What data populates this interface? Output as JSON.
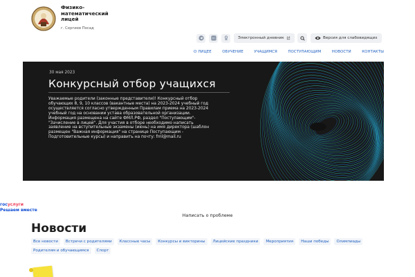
{
  "header": {
    "school_name_lines": [
      "Физико-",
      "математический",
      "лицей"
    ],
    "city": "г. Сергиев Посад",
    "diary_label": "Электронный дневник",
    "vision_label": "Версия для слабовидящих",
    "icons": [
      "telegram-icon",
      "vk-icon",
      "ok-icon",
      "search-icon",
      "eye-icon"
    ]
  },
  "nav": {
    "items": [
      "О ЛИЦЕЕ",
      "ОБУЧЕНИЕ",
      "УЧАЩИМСЯ",
      "ПОСТУПАЮЩИМ",
      "НОВОСТИ",
      "КОНТАКТЫ"
    ]
  },
  "hero": {
    "date": "30 мая 2023",
    "title": "Конкурсный отбор учащихся",
    "body": "Уважаемые родители (законные представители)! Конкурсный отбор обучающих 8, 9, 10 классов (вакантные места) на 2023-2024 учебный год осуществляется согласно утвержденным Правилам приема на 2023-2024 учебный год на основании устава образовательной организации. Информация размещена на сайте ФМЛ.РФ, раздел \"Поступающим\"-\"Зачисление в лицей\". Для участия в отборе необходимо написать заявление на вступительные экзамены (июнь) на имя директора (шаблон размещен \"Важная информация\" на странице Поступающим - Подготовительные курсы) и направить на почту: fml@mail.ru"
  },
  "gosuslugi": {
    "logo_part1": "гос",
    "logo_part2": "услуги",
    "tagline": "Решаем вместе"
  },
  "feedback": {
    "label": "Написать о проблеме"
  },
  "news": {
    "title": "Новости",
    "tags": [
      "Все новости",
      "Встречи с родителями",
      "Классные часы",
      "Конкурсы и викторины",
      "Лицейские праздники",
      "Мероприятия",
      "Наши победы",
      "Олимпиады",
      "Родителям и обучающимся",
      "Спорт"
    ]
  },
  "colors": {
    "accent": "#1f5fbf",
    "hero_bg": "#181818",
    "spiral_cyan": "#2fd3c9",
    "spiral_blue": "#1a7fe0"
  }
}
